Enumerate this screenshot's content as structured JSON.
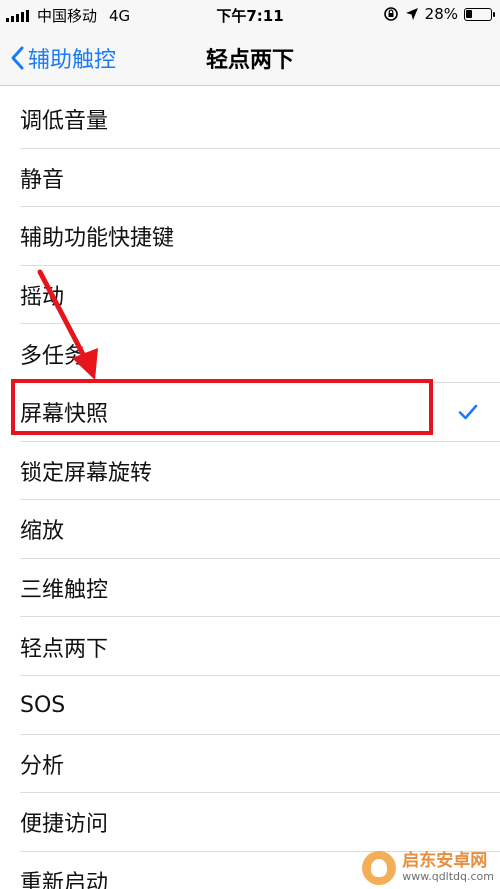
{
  "status_bar": {
    "carrier": "中国移动",
    "network": "4G",
    "time": "下午7:11",
    "battery_percent": "28%",
    "battery_level": 0.28
  },
  "nav": {
    "back_label": "辅助触控",
    "title": "轻点两下"
  },
  "list": {
    "items": [
      {
        "label": "调低音量"
      },
      {
        "label": "静音"
      },
      {
        "label": "辅助功能快捷键"
      },
      {
        "label": "摇动"
      },
      {
        "label": "多任务"
      },
      {
        "label": "屏幕快照"
      },
      {
        "label": "锁定屏幕旋转"
      },
      {
        "label": "缩放"
      },
      {
        "label": "三维触控"
      },
      {
        "label": "轻点两下"
      },
      {
        "label": "SOS"
      },
      {
        "label": "分析"
      },
      {
        "label": "便捷访问"
      },
      {
        "label": "重新启动"
      }
    ],
    "selected_index": 5
  },
  "watermark": {
    "title": "启东安卓网",
    "url": "www.qdltdq.com"
  },
  "colors": {
    "accent": "#1a7cf5",
    "annotation": "#e8141c"
  }
}
